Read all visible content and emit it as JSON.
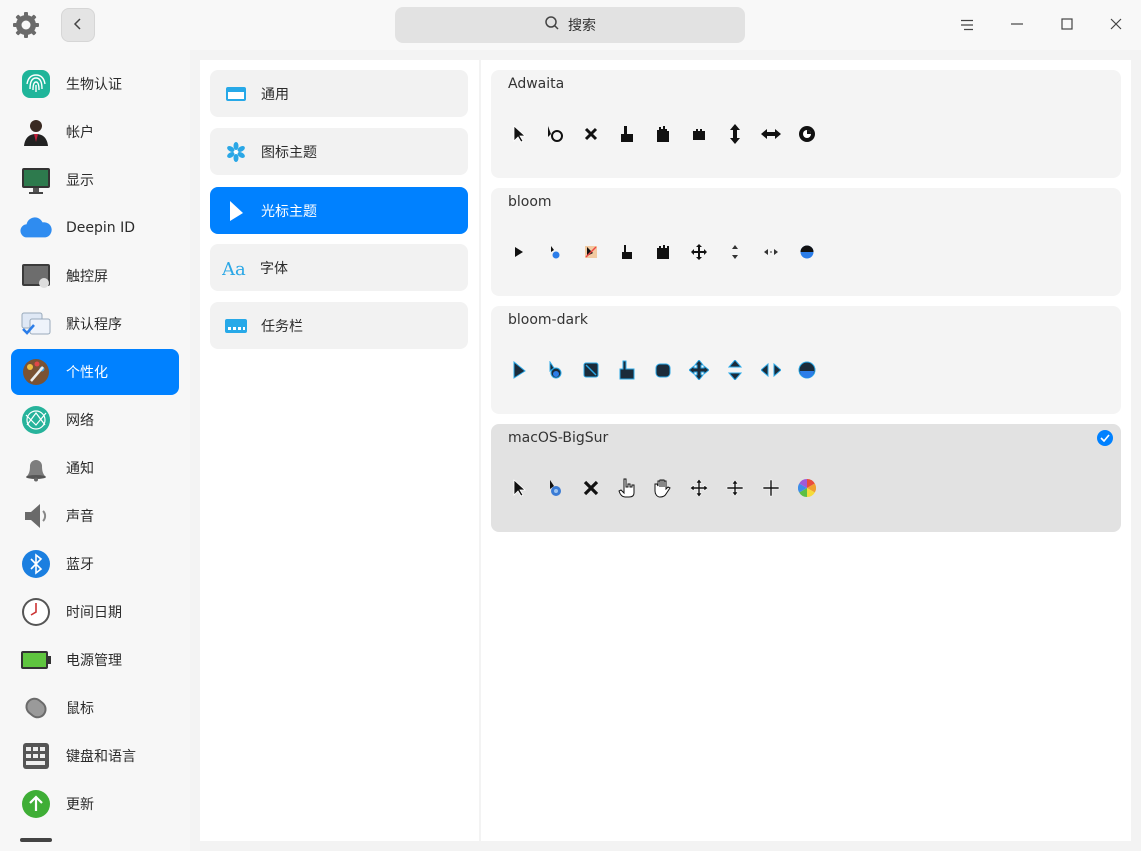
{
  "window": {
    "search_placeholder": "搜索"
  },
  "nav": {
    "items": [
      {
        "label": "生物认证",
        "icon": "fingerprint-icon"
      },
      {
        "label": "帐户",
        "icon": "account-icon"
      },
      {
        "label": "显示",
        "icon": "display-icon"
      },
      {
        "label": "Deepin ID",
        "icon": "cloud-icon"
      },
      {
        "label": "触控屏",
        "icon": "touchscreen-icon"
      },
      {
        "label": "默认程序",
        "icon": "default-apps-icon"
      },
      {
        "label": "个性化",
        "icon": "palette-icon"
      },
      {
        "label": "网络",
        "icon": "network-icon"
      },
      {
        "label": "通知",
        "icon": "bell-icon"
      },
      {
        "label": "声音",
        "icon": "speaker-icon"
      },
      {
        "label": "蓝牙",
        "icon": "bluetooth-icon"
      },
      {
        "label": "时间日期",
        "icon": "clock-icon"
      },
      {
        "label": "电源管理",
        "icon": "battery-icon"
      },
      {
        "label": "鼠标",
        "icon": "mouse-icon"
      },
      {
        "label": "键盘和语言",
        "icon": "keyboard-icon"
      },
      {
        "label": "更新",
        "icon": "update-icon"
      }
    ],
    "active_index": 6
  },
  "personalization": {
    "items": [
      {
        "label": "通用",
        "icon": "window-icon"
      },
      {
        "label": "图标主题",
        "icon": "snowflake-icon"
      },
      {
        "label": "光标主题",
        "icon": "cursor-icon"
      },
      {
        "label": "字体",
        "icon": "font-icon"
      },
      {
        "label": "任务栏",
        "icon": "taskbar-icon"
      }
    ],
    "active_index": 2
  },
  "cursor_themes": [
    {
      "name": "Adwaita",
      "selected": false
    },
    {
      "name": "bloom",
      "selected": false
    },
    {
      "name": "bloom-dark",
      "selected": false
    },
    {
      "name": "macOS-BigSur",
      "selected": true
    }
  ],
  "colors": {
    "accent": "#0081ff"
  }
}
